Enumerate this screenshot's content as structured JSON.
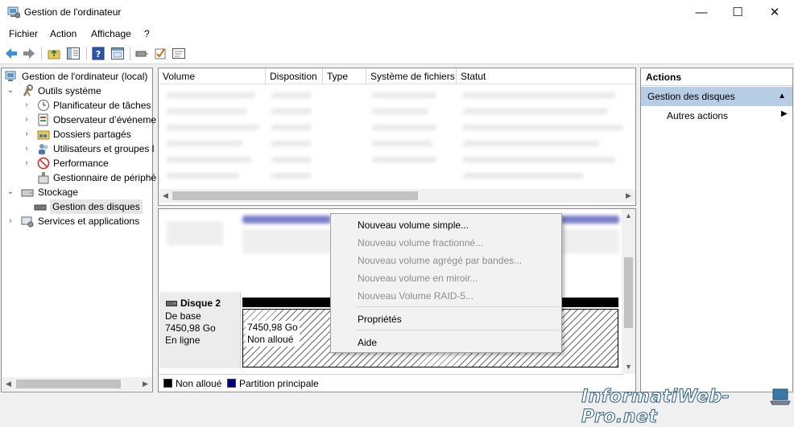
{
  "window": {
    "title": "Gestion de l'ordinateur",
    "controls": {
      "minimize": "—",
      "maximize": "☐",
      "close": "✕"
    }
  },
  "menu": [
    "Fichier",
    "Action",
    "Affichage",
    "?"
  ],
  "toolbar": [
    "back-icon",
    "forward-icon",
    "up-folder-icon",
    "show-hide-tree-icon",
    "help-icon",
    "properties-icon",
    "connect-drive-icon",
    "check-icon",
    "console-icon"
  ],
  "tree": {
    "root": "Gestion de l'ordinateur (local)",
    "outils": "Outils système",
    "planificateur": "Planificateur de tâches",
    "observateur": "Observateur d’événeme",
    "dossiers": "Dossiers partagés",
    "utilisateurs": "Utilisateurs et groupes l",
    "performance": "Performance",
    "peripheriques": "Gestionnaire de périphé",
    "stockage": "Stockage",
    "disques": "Gestion des disques",
    "services": "Services et applications"
  },
  "volume_list": {
    "columns": [
      "Volume",
      "Disposition",
      "Type",
      "Système de fichiers",
      "Statut"
    ]
  },
  "disk": {
    "name": "Disque 2",
    "type": "De base",
    "size": "7450,98 Go",
    "status": "En ligne",
    "partition_size": "7450,98 Go",
    "partition_status": "Non alloué"
  },
  "legend": {
    "unallocated": "Non alloué",
    "primary": "Partition principale",
    "unallocated_color": "#000000",
    "primary_color": "#000080"
  },
  "context_menu": {
    "new_simple": "Nouveau volume simple...",
    "new_spanned": "Nouveau volume fractionné...",
    "new_striped": "Nouveau volume agrégé par bandes...",
    "new_mirror": "Nouveau volume en miroir...",
    "new_raid5": "Nouveau Volume RAID-5...",
    "properties": "Propriétés",
    "help": "Aide"
  },
  "actions": {
    "header": "Actions",
    "group": "Gestion des disques",
    "more": "Autres actions"
  },
  "watermark": "InformatiWeb-Pro.net"
}
